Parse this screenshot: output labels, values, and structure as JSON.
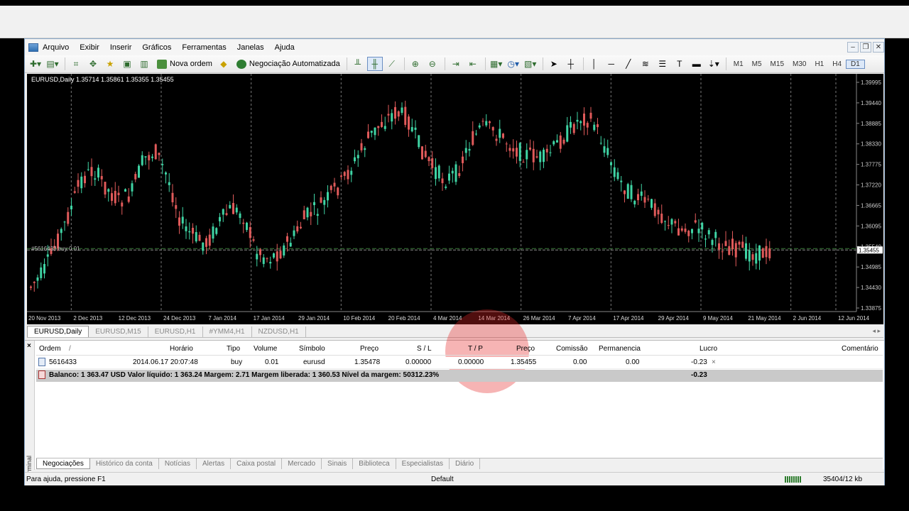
{
  "menu": [
    "Arquivo",
    "Exibir",
    "Inserir",
    "Gráficos",
    "Ferramentas",
    "Janelas",
    "Ajuda"
  ],
  "toolbar": {
    "new_order": "Nova ordem",
    "auto_trading": "Negociação Automatizada",
    "timeframes": [
      "M1",
      "M5",
      "M15",
      "M30",
      "H1",
      "H4",
      "D1"
    ],
    "active_timeframe": "D1"
  },
  "chart": {
    "info": "EURUSD,Daily  1.35714 1.35861 1.35355 1.35455",
    "order_tag": "#5616433 buy 0.01",
    "current_price": "1.35455",
    "y_ticks": [
      "1.39995",
      "1.39440",
      "1.38885",
      "1.38330",
      "1.37775",
      "1.37220",
      "1.36665",
      "1.36095",
      "1.35540",
      "1.34985",
      "1.34430",
      "1.33875"
    ],
    "x_labels": [
      "20 Nov 2013",
      "2 Dec 2013",
      "12 Dec 2013",
      "24 Dec 2013",
      "7 Jan 2014",
      "17 Jan 2014",
      "29 Jan 2014",
      "10 Feb 2014",
      "20 Feb 2014",
      "4 Mar 2014",
      "14 Mar 2014",
      "26 Mar 2014",
      "7 Apr 2014",
      "17 Apr 2014",
      "29 Apr 2014",
      "9 May 2014",
      "21 May 2014",
      "2 Jun 2014",
      "12 Jun 2014"
    ],
    "bull_color": "#3fd4a4",
    "bear_color": "#e05a5a"
  },
  "chart_tabs": [
    "EURUSD,Daily",
    "EURUSD,M15",
    "EURUSD,H1",
    "#YMM4,H1",
    "NZDUSD,H1"
  ],
  "terminal": {
    "headers": {
      "ordem": "Ordem",
      "sort": "/",
      "horario": "Horário",
      "tipo": "Tipo",
      "volume": "Volume",
      "simbolo": "Símbolo",
      "preco": "Preço",
      "sl": "S / L",
      "tp": "T / P",
      "preco2": "Preço",
      "comissao": "Comissão",
      "permanencia": "Permanencia",
      "lucro": "Lucro",
      "comentario": "Comentário"
    },
    "row": {
      "ordem": "5616433",
      "horario": "2014.06.17 20:07:48",
      "tipo": "buy",
      "volume": "0.01",
      "simbolo": "eurusd",
      "preco": "1.35478",
      "sl": "0.00000",
      "tp": "0.00000",
      "preco2": "1.35455",
      "comissao": "0.00",
      "permanencia": "0.00",
      "lucro": "-0.23"
    },
    "balance": "Balanco: 1 363.47 USD  Valor líquido: 1 363.24  Margem: 2.71  Margem liberada: 1 360.53  Nível da margem: 50312.23%",
    "balance_profit": "-0.23",
    "side_label": "Terminal",
    "tabs": [
      "Negociações",
      "Histórico da conta",
      "Notícias",
      "Alertas",
      "Caixa postal",
      "Mercado",
      "Sinais",
      "Biblioteca",
      "Especialistas",
      "Diário"
    ]
  },
  "status": {
    "help": "Para ajuda, pressione F1",
    "profile": "Default",
    "traffic": "35404/12 kb"
  }
}
